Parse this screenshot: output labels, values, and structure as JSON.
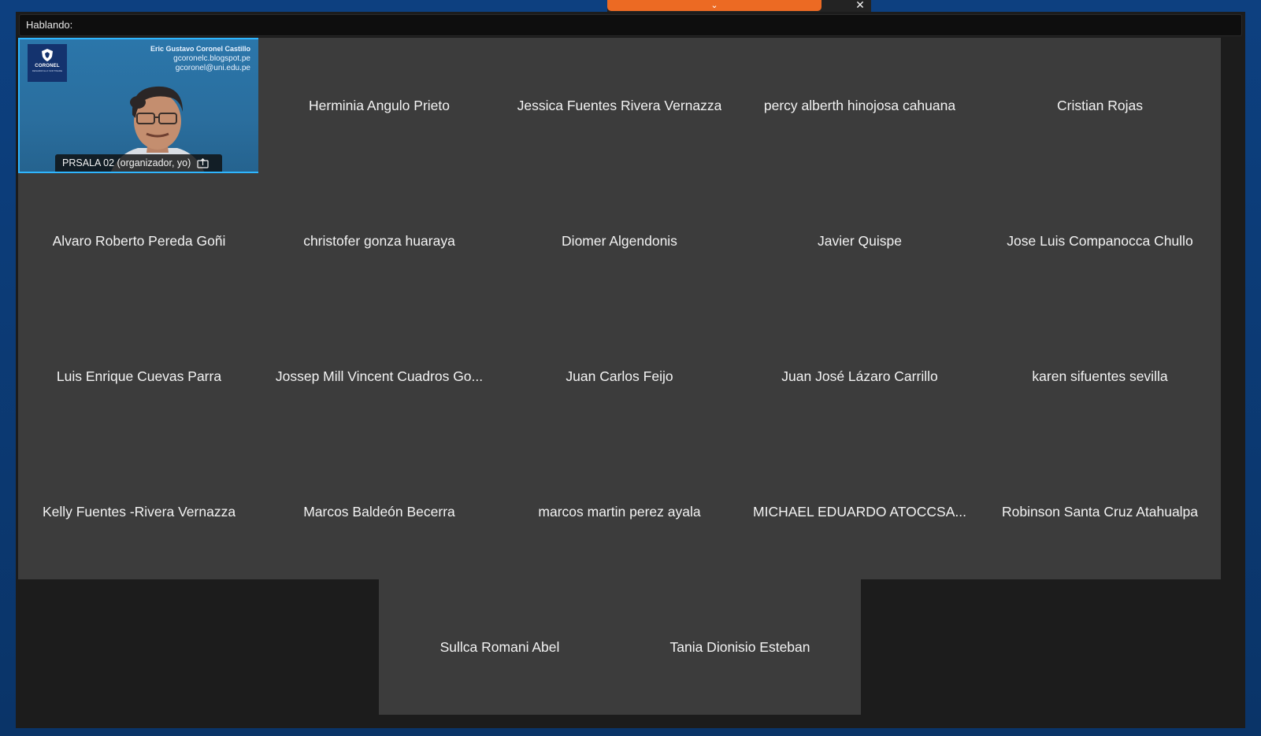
{
  "window": {
    "speaking_label": "Hablando:"
  },
  "top_controls": {
    "expand_glyph": "⌄",
    "close_glyph": "✕"
  },
  "self_video": {
    "logo_text": "CORONEL",
    "logo_subtext": "DESARROLLO SOFTWARE",
    "overlay_name": "Eric Gustavo Coronel Castillo",
    "overlay_blog": "gcoronelc.blogspot.pe",
    "overlay_email": "gcoronel@uni.edu.pe",
    "label": "PRSALA 02  (organizador, yo)",
    "share_icon": "share-screen-icon"
  },
  "participants": [
    {
      "name": "Herminia Angulo Prieto"
    },
    {
      "name": "Jessica Fuentes Rivera Vernazza"
    },
    {
      "name": "percy alberth hinojosa cahuana"
    },
    {
      "name": "Cristian Rojas"
    },
    {
      "name": "Alvaro Roberto Pereda Goñi"
    },
    {
      "name": "christofer gonza huaraya"
    },
    {
      "name": "Diomer Algendonis"
    },
    {
      "name": "Javier Quispe"
    },
    {
      "name": "Jose Luis Companocca Chullo"
    },
    {
      "name": "Luis Enrique Cuevas Parra"
    },
    {
      "name": "Jossep Mill Vincent Cuadros Go..."
    },
    {
      "name": "Juan Carlos Feijo"
    },
    {
      "name": "Juan José Lázaro Carrillo"
    },
    {
      "name": "karen sifuentes sevilla"
    },
    {
      "name": "Kelly Fuentes -Rivera Vernazza"
    },
    {
      "name": "Marcos Baldeón Becerra"
    },
    {
      "name": "marcos martin perez ayala"
    },
    {
      "name": "MICHAEL EDUARDO ATOCCSA..."
    },
    {
      "name": "Robinson Santa Cruz Atahualpa"
    },
    {
      "name": "Sullca Romani Abel"
    },
    {
      "name": "Tania Dionisio Esteban"
    }
  ],
  "colors": {
    "desktop_bg": "#0b3b74",
    "accent_orange": "#ec6a23",
    "active_speaker_border": "#2fb6ff",
    "tile_bg": "#3c3c3c"
  }
}
